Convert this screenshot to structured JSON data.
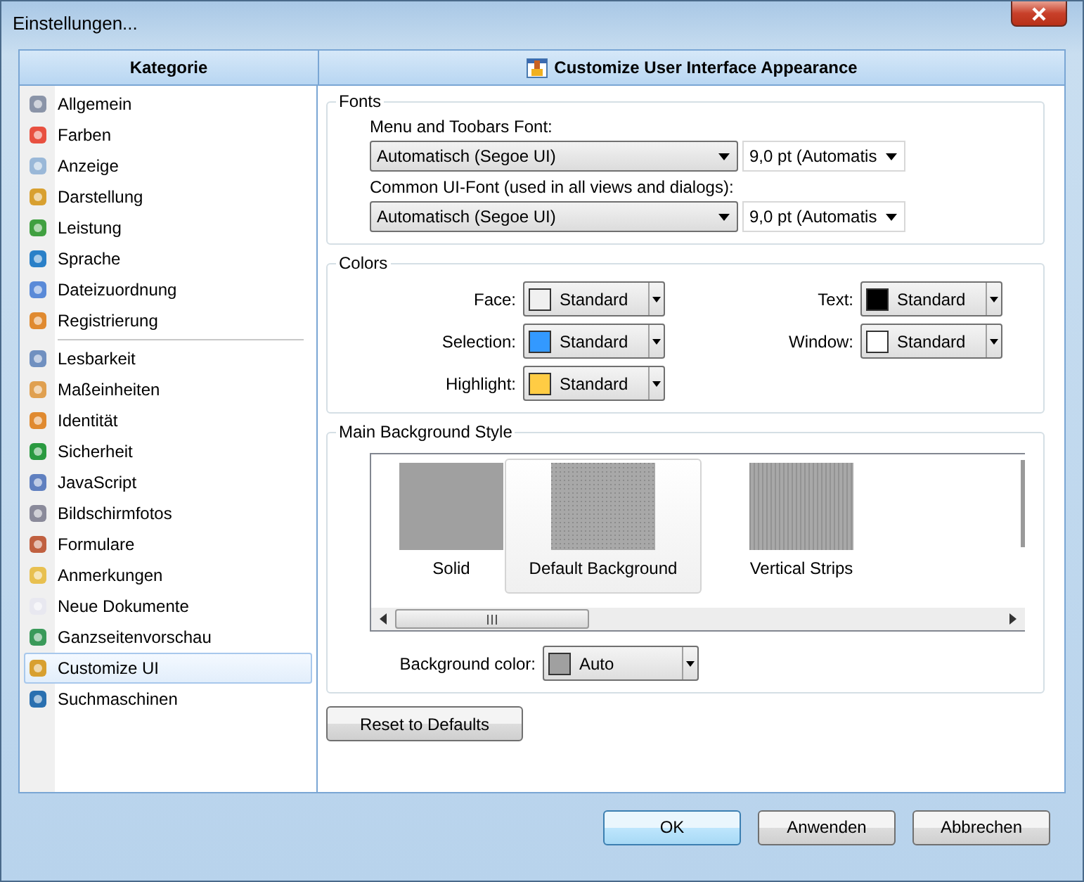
{
  "window": {
    "title": "Einstellungen..."
  },
  "sidebar": {
    "header": "Kategorie",
    "groups": [
      [
        {
          "label": "Allgemein",
          "selected": false
        },
        {
          "label": "Farben",
          "selected": false
        },
        {
          "label": "Anzeige",
          "selected": false
        },
        {
          "label": "Darstellung",
          "selected": false
        },
        {
          "label": "Leistung",
          "selected": false
        },
        {
          "label": "Sprache",
          "selected": false
        },
        {
          "label": "Dateizuordnung",
          "selected": false
        },
        {
          "label": "Registrierung",
          "selected": false
        }
      ],
      [
        {
          "label": "Lesbarkeit",
          "selected": false
        },
        {
          "label": "Maßeinheiten",
          "selected": false
        },
        {
          "label": "Identität",
          "selected": false
        },
        {
          "label": "Sicherheit",
          "selected": false
        },
        {
          "label": "JavaScript",
          "selected": false
        },
        {
          "label": "Bildschirmfotos",
          "selected": false
        },
        {
          "label": "Formulare",
          "selected": false
        },
        {
          "label": "Anmerkungen",
          "selected": false
        },
        {
          "label": "Neue Dokumente",
          "selected": false
        },
        {
          "label": "Ganzseitenvorschau",
          "selected": false
        },
        {
          "label": "Customize UI",
          "selected": true
        },
        {
          "label": "Suchmaschinen",
          "selected": false
        }
      ]
    ]
  },
  "panel": {
    "title": "Customize User Interface Appearance",
    "fonts": {
      "legend": "Fonts",
      "rows": [
        {
          "label": "Menu and Toobars Font:",
          "font": "Automatisch (Segoe UI)",
          "size": "9,0 pt (Automatis"
        },
        {
          "label": "Common UI-Font (used in all views and dialogs):",
          "font": "Automatisch (Segoe UI)",
          "size": "9,0 pt (Automatis"
        }
      ]
    },
    "colors": {
      "legend": "Colors",
      "items": [
        {
          "label": "Face:",
          "value": "Standard",
          "color": "#f0f0f0"
        },
        {
          "label": "Text:",
          "value": "Standard",
          "color": "#000000"
        },
        {
          "label": "Selection:",
          "value": "Standard",
          "color": "#3399ff"
        },
        {
          "label": "Window:",
          "value": "Standard",
          "color": "#ffffff"
        },
        {
          "label": "Highlight:",
          "value": "Standard",
          "color": "#ffcc44"
        }
      ]
    },
    "background": {
      "legend": "Main Background Style",
      "styles": [
        {
          "label": "Solid",
          "selected": false
        },
        {
          "label": "Default Background",
          "selected": true
        },
        {
          "label": "Vertical Strips",
          "selected": false
        }
      ],
      "color_label": "Background color:",
      "color_value": "Auto",
      "color": "#a0a0a0"
    },
    "reset_button": "Reset to Defaults"
  },
  "buttons": [
    {
      "label": "OK",
      "default": true
    },
    {
      "label": "Anwenden",
      "default": false
    },
    {
      "label": "Abbrechen",
      "default": false
    }
  ]
}
